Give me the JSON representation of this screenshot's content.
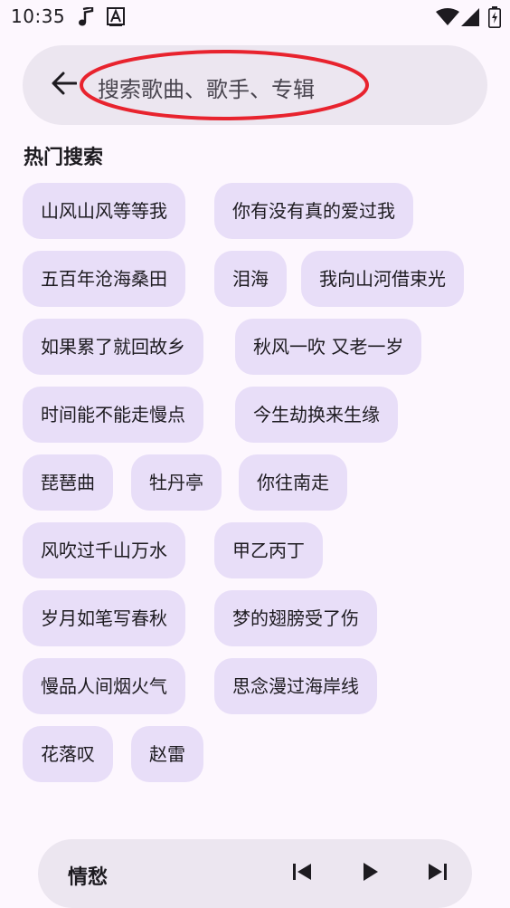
{
  "status_bar": {
    "time": "10:35",
    "icons": [
      "music-note-icon",
      "keyboard-a-icon",
      "wifi-icon",
      "cell-signal-icon",
      "battery-charging-icon"
    ]
  },
  "search": {
    "placeholder": "搜索歌曲、歌手、专辑",
    "highlight_color": "#e8232e"
  },
  "section": {
    "title": "热门搜索"
  },
  "chips": [
    "山风山风等等我",
    "你有没有真的爱过我",
    "五百年沧海桑田",
    "泪海",
    "我向山河借束光",
    "如果累了就回故乡",
    "秋风一吹 又老一岁",
    "时间能不能走慢点",
    "今生劫换来生缘",
    "琵琶曲",
    "牡丹亭",
    "你往南走",
    "风吹过千山万水",
    "甲乙丙丁",
    "岁月如笔写春秋",
    "梦的翅膀受了伤",
    "慢品人间烟火气",
    "思念漫过海岸线",
    "花落叹",
    "赵雷"
  ],
  "player": {
    "title": "情愁",
    "controls": [
      "skip-previous-icon",
      "play-icon",
      "skip-next-icon"
    ]
  },
  "colors": {
    "background": "#fdf7fe",
    "surface": "#ece6f0",
    "chip": "#e8def8",
    "text": "#1d1b20"
  }
}
